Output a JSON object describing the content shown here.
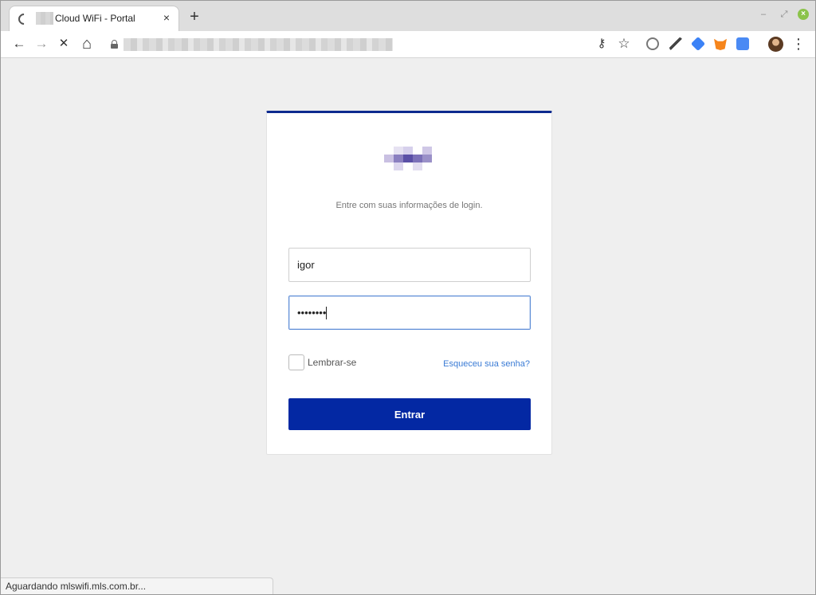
{
  "browser": {
    "tab_title": "Cloud WiFi - Portal",
    "tab_close_glyph": "×",
    "new_tab_glyph": "+",
    "window_min_glyph": "–",
    "window_max_glyph": "⤢",
    "window_close_glyph": "×",
    "back_glyph": "←",
    "forward_glyph": "→",
    "stop_glyph": "✕",
    "home_glyph": "⌂",
    "key_glyph": "⚷",
    "star_glyph": "☆",
    "menu_glyph": "⋮",
    "status_text": "Aguardando mlswifi.mls.com.br..."
  },
  "login": {
    "subtitle": "Entre com suas informações de login.",
    "username_value": "igor",
    "password_value": "********",
    "remember_label": "Lembrar-se",
    "forgot_link": "Esqueceu sua senha?",
    "submit_label": "Entrar"
  },
  "colors": {
    "accent": "#0328a3",
    "card_top_border": "#0d2a8f",
    "link": "#3a7bd5",
    "focus_border": "#5b8bd6"
  },
  "icons": {
    "extensions": [
      "extension-globe-icon",
      "color-picker-icon",
      "extension-blue-icon",
      "metamask-fox-icon",
      "google-translate-icon"
    ]
  }
}
